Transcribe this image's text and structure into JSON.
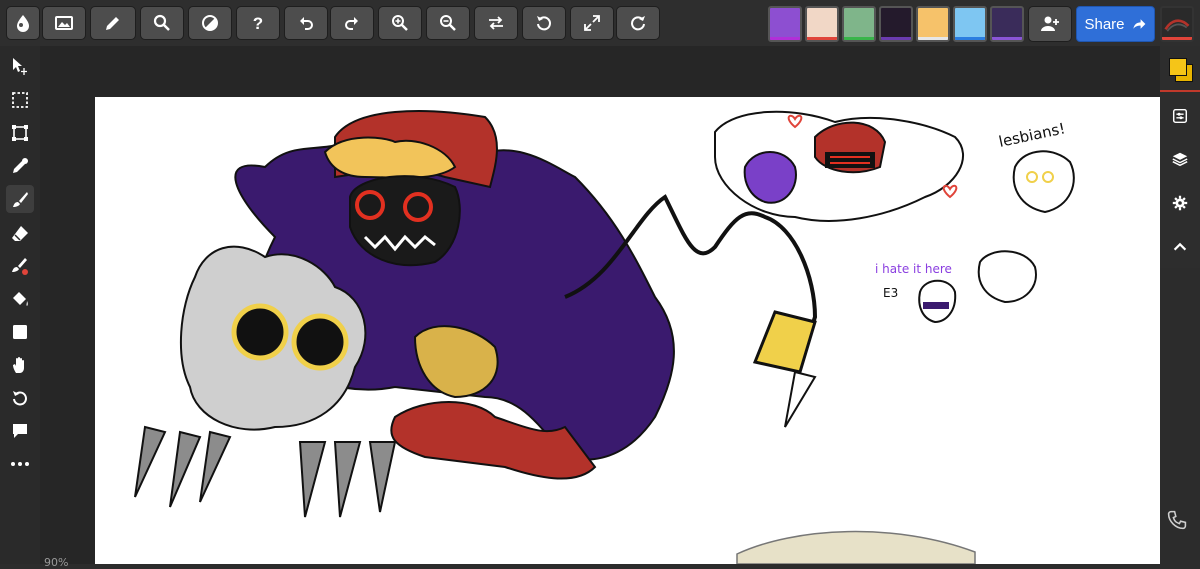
{
  "toolbar": {
    "buttons": [
      "app-logo",
      "insert-image",
      "edit",
      "search",
      "contrast",
      "help",
      "undo",
      "redo",
      "zoom-in",
      "zoom-out",
      "flip",
      "rotate-reset",
      "fullscreen",
      "refresh"
    ],
    "add_user_label": "add user",
    "share_label": "Share"
  },
  "collaborators": [
    {
      "name": "collaborator-1",
      "bg": "#8d4fd1",
      "accent": "#b22fd8"
    },
    {
      "name": "collaborator-2",
      "bg": "#f1d7c6",
      "accent": "#e0443a"
    },
    {
      "name": "collaborator-3",
      "bg": "#7fb58a",
      "accent": "#39b54a"
    },
    {
      "name": "collaborator-4",
      "bg": "#241a2c",
      "accent": "#6a3bb0"
    },
    {
      "name": "collaborator-5",
      "bg": "#f6c26a",
      "accent": "#e6e6e6"
    },
    {
      "name": "collaborator-6",
      "bg": "#7ec6f2",
      "accent": "#2b7de0"
    },
    {
      "name": "collaborator-7",
      "bg": "#3a2c5a",
      "accent": "#8a55d6"
    }
  ],
  "current_color": "#f5c518",
  "secondary_color": "#e8b400",
  "canvas": {
    "caption_lesbians": "lesbians!",
    "caption_hate": "i hate it here",
    "caption_e3": "E3"
  },
  "status": {
    "zoom": "90%"
  },
  "colors": {
    "purple": "#3a1a6e",
    "red": "#b3322a",
    "yellow": "#f0d04a",
    "tan": "#d9b24a",
    "gray": "#8c8c8c"
  }
}
